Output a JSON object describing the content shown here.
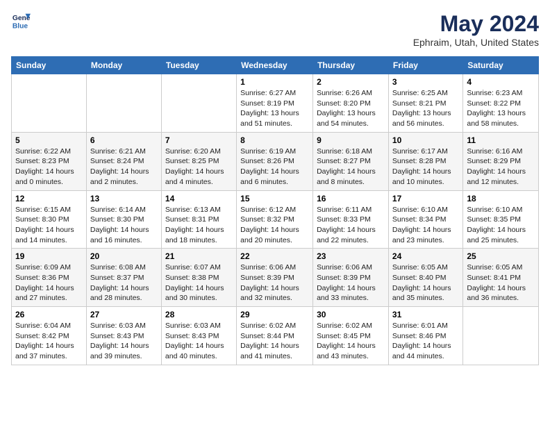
{
  "header": {
    "logo_line1": "General",
    "logo_line2": "Blue",
    "month_title": "May 2024",
    "location": "Ephraim, Utah, United States"
  },
  "weekdays": [
    "Sunday",
    "Monday",
    "Tuesday",
    "Wednesday",
    "Thursday",
    "Friday",
    "Saturday"
  ],
  "weeks": [
    [
      {
        "day": "",
        "info": ""
      },
      {
        "day": "",
        "info": ""
      },
      {
        "day": "",
        "info": ""
      },
      {
        "day": "1",
        "info": "Sunrise: 6:27 AM\nSunset: 8:19 PM\nDaylight: 13 hours\nand 51 minutes."
      },
      {
        "day": "2",
        "info": "Sunrise: 6:26 AM\nSunset: 8:20 PM\nDaylight: 13 hours\nand 54 minutes."
      },
      {
        "day": "3",
        "info": "Sunrise: 6:25 AM\nSunset: 8:21 PM\nDaylight: 13 hours\nand 56 minutes."
      },
      {
        "day": "4",
        "info": "Sunrise: 6:23 AM\nSunset: 8:22 PM\nDaylight: 13 hours\nand 58 minutes."
      }
    ],
    [
      {
        "day": "5",
        "info": "Sunrise: 6:22 AM\nSunset: 8:23 PM\nDaylight: 14 hours\nand 0 minutes."
      },
      {
        "day": "6",
        "info": "Sunrise: 6:21 AM\nSunset: 8:24 PM\nDaylight: 14 hours\nand 2 minutes."
      },
      {
        "day": "7",
        "info": "Sunrise: 6:20 AM\nSunset: 8:25 PM\nDaylight: 14 hours\nand 4 minutes."
      },
      {
        "day": "8",
        "info": "Sunrise: 6:19 AM\nSunset: 8:26 PM\nDaylight: 14 hours\nand 6 minutes."
      },
      {
        "day": "9",
        "info": "Sunrise: 6:18 AM\nSunset: 8:27 PM\nDaylight: 14 hours\nand 8 minutes."
      },
      {
        "day": "10",
        "info": "Sunrise: 6:17 AM\nSunset: 8:28 PM\nDaylight: 14 hours\nand 10 minutes."
      },
      {
        "day": "11",
        "info": "Sunrise: 6:16 AM\nSunset: 8:29 PM\nDaylight: 14 hours\nand 12 minutes."
      }
    ],
    [
      {
        "day": "12",
        "info": "Sunrise: 6:15 AM\nSunset: 8:30 PM\nDaylight: 14 hours\nand 14 minutes."
      },
      {
        "day": "13",
        "info": "Sunrise: 6:14 AM\nSunset: 8:30 PM\nDaylight: 14 hours\nand 16 minutes."
      },
      {
        "day": "14",
        "info": "Sunrise: 6:13 AM\nSunset: 8:31 PM\nDaylight: 14 hours\nand 18 minutes."
      },
      {
        "day": "15",
        "info": "Sunrise: 6:12 AM\nSunset: 8:32 PM\nDaylight: 14 hours\nand 20 minutes."
      },
      {
        "day": "16",
        "info": "Sunrise: 6:11 AM\nSunset: 8:33 PM\nDaylight: 14 hours\nand 22 minutes."
      },
      {
        "day": "17",
        "info": "Sunrise: 6:10 AM\nSunset: 8:34 PM\nDaylight: 14 hours\nand 23 minutes."
      },
      {
        "day": "18",
        "info": "Sunrise: 6:10 AM\nSunset: 8:35 PM\nDaylight: 14 hours\nand 25 minutes."
      }
    ],
    [
      {
        "day": "19",
        "info": "Sunrise: 6:09 AM\nSunset: 8:36 PM\nDaylight: 14 hours\nand 27 minutes."
      },
      {
        "day": "20",
        "info": "Sunrise: 6:08 AM\nSunset: 8:37 PM\nDaylight: 14 hours\nand 28 minutes."
      },
      {
        "day": "21",
        "info": "Sunrise: 6:07 AM\nSunset: 8:38 PM\nDaylight: 14 hours\nand 30 minutes."
      },
      {
        "day": "22",
        "info": "Sunrise: 6:06 AM\nSunset: 8:39 PM\nDaylight: 14 hours\nand 32 minutes."
      },
      {
        "day": "23",
        "info": "Sunrise: 6:06 AM\nSunset: 8:39 PM\nDaylight: 14 hours\nand 33 minutes."
      },
      {
        "day": "24",
        "info": "Sunrise: 6:05 AM\nSunset: 8:40 PM\nDaylight: 14 hours\nand 35 minutes."
      },
      {
        "day": "25",
        "info": "Sunrise: 6:05 AM\nSunset: 8:41 PM\nDaylight: 14 hours\nand 36 minutes."
      }
    ],
    [
      {
        "day": "26",
        "info": "Sunrise: 6:04 AM\nSunset: 8:42 PM\nDaylight: 14 hours\nand 37 minutes."
      },
      {
        "day": "27",
        "info": "Sunrise: 6:03 AM\nSunset: 8:43 PM\nDaylight: 14 hours\nand 39 minutes."
      },
      {
        "day": "28",
        "info": "Sunrise: 6:03 AM\nSunset: 8:43 PM\nDaylight: 14 hours\nand 40 minutes."
      },
      {
        "day": "29",
        "info": "Sunrise: 6:02 AM\nSunset: 8:44 PM\nDaylight: 14 hours\nand 41 minutes."
      },
      {
        "day": "30",
        "info": "Sunrise: 6:02 AM\nSunset: 8:45 PM\nDaylight: 14 hours\nand 43 minutes."
      },
      {
        "day": "31",
        "info": "Sunrise: 6:01 AM\nSunset: 8:46 PM\nDaylight: 14 hours\nand 44 minutes."
      },
      {
        "day": "",
        "info": ""
      }
    ]
  ]
}
